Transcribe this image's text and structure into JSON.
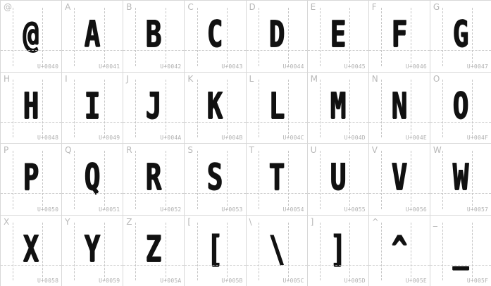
{
  "glyphs": [
    {
      "char": "@",
      "code": "U+0040"
    },
    {
      "char": "A",
      "code": "U+0041"
    },
    {
      "char": "B",
      "code": "U+0042"
    },
    {
      "char": "C",
      "code": "U+0043"
    },
    {
      "char": "D",
      "code": "U+0044"
    },
    {
      "char": "E",
      "code": "U+0045"
    },
    {
      "char": "F",
      "code": "U+0046"
    },
    {
      "char": "G",
      "code": "U+0047"
    },
    {
      "char": "H",
      "code": "U+0048"
    },
    {
      "char": "I",
      "code": "U+0049"
    },
    {
      "char": "J",
      "code": "U+004A"
    },
    {
      "char": "K",
      "code": "U+004B"
    },
    {
      "char": "L",
      "code": "U+004C"
    },
    {
      "char": "M",
      "code": "U+004D"
    },
    {
      "char": "N",
      "code": "U+004E"
    },
    {
      "char": "O",
      "code": "U+004F"
    },
    {
      "char": "P",
      "code": "U+0050"
    },
    {
      "char": "Q",
      "code": "U+0051"
    },
    {
      "char": "R",
      "code": "U+0052"
    },
    {
      "char": "S",
      "code": "U+0053"
    },
    {
      "char": "T",
      "code": "U+0054"
    },
    {
      "char": "U",
      "code": "U+0055"
    },
    {
      "char": "V",
      "code": "U+0056"
    },
    {
      "char": "W",
      "code": "U+0057"
    },
    {
      "char": "X",
      "code": "U+0058"
    },
    {
      "char": "Y",
      "code": "U+0059"
    },
    {
      "char": "Z",
      "code": "U+005A"
    },
    {
      "char": "[",
      "code": "U+005B"
    },
    {
      "char": "\\",
      "code": "U+005C"
    },
    {
      "char": "]",
      "code": "U+005D"
    },
    {
      "char": "^",
      "code": "U+005E"
    },
    {
      "char": "_",
      "code": "U+005F"
    }
  ]
}
